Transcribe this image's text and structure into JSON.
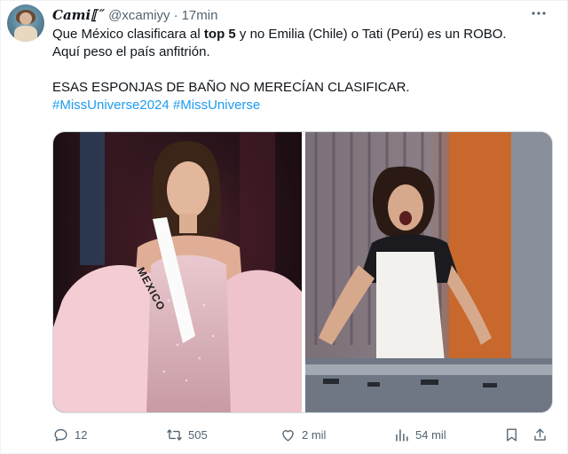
{
  "tweet": {
    "display_name": "Camiٳ̵͈",
    "display_name_visible": "Cami⟦˝",
    "handle": "@xcamiyy",
    "separator": "·",
    "time": "17min",
    "lines": {
      "l1_a": "Que México clasificara al ",
      "l1_bold": "top 5",
      "l1_b": " y no Emilia (Chile) o Tati (Perú) es un ROBO.",
      "l2": "Aquí peso el país anfitrión.",
      "l3": "ESAS ESPONJAS DE BAÑO NO MERECÍAN CLASIFICAR.",
      "hashtag1": "#MissUniverse2024",
      "hashtag2": "#MissUniverse"
    },
    "media": {
      "left_sash_text": "MEXICO"
    },
    "actions": {
      "replies": "12",
      "reposts": "505",
      "likes": "2 mil",
      "views": "54 mil"
    }
  },
  "icons": {
    "more": "more-icon",
    "reply": "reply-icon",
    "repost": "repost-icon",
    "like": "like-icon",
    "views": "views-icon",
    "bookmark": "bookmark-icon",
    "share": "share-icon"
  },
  "colors": {
    "text": "#0f1419",
    "secondary": "#536471",
    "link": "#1d9bf0",
    "border": "#cfd9de"
  }
}
